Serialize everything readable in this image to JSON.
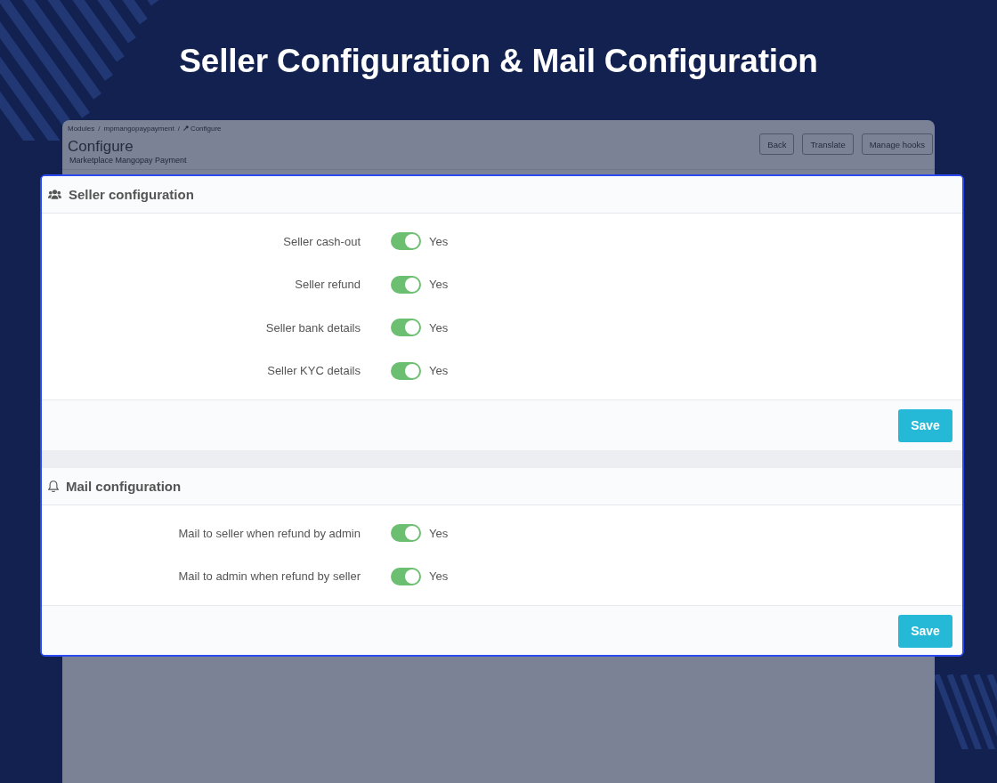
{
  "page_title": "Seller Configuration & Mail Configuration",
  "background_screen": {
    "breadcrumb": [
      {
        "label": "Modules",
        "separator": "/"
      },
      {
        "label": "mpmangopaypayment",
        "separator": "/"
      },
      {
        "label": "Configure"
      }
    ],
    "title": "Configure",
    "subtitle": "Marketplace Mangopay Payment",
    "buttons": [
      "Back",
      "Translate",
      "Manage hooks"
    ]
  },
  "panels": [
    {
      "kind": "seller",
      "title": "Seller configuration",
      "settings": [
        {
          "label": "Seller cash-out",
          "on": true,
          "state_label": "Yes"
        },
        {
          "label": "Seller refund",
          "on": true,
          "state_label": "Yes"
        },
        {
          "label": "Seller bank details",
          "on": true,
          "state_label": "Yes"
        },
        {
          "label": "Seller KYC details",
          "on": true,
          "state_label": "Yes"
        }
      ],
      "button": "Save"
    },
    {
      "kind": "mail",
      "title": "Mail configuration",
      "settings": [
        {
          "label": "Mail to seller when refund by admin",
          "on": true,
          "state_label": "Yes"
        },
        {
          "label": "Mail to admin when refund by seller",
          "on": true,
          "state_label": "Yes"
        }
      ],
      "button": "Save"
    }
  ]
}
